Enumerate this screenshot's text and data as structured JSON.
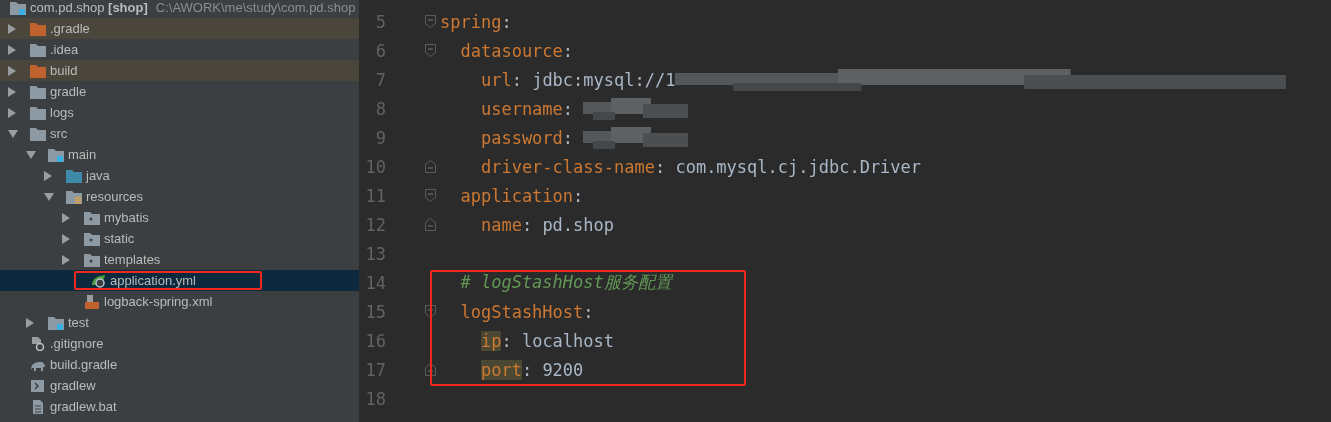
{
  "project_tree": {
    "root": {
      "name": "com.pd.shop **[shop]**",
      "path": "C:\\AWORK\\me\\study\\com.pd.shop"
    },
    "items": [
      {
        "name": ".gradle",
        "kind": "folder",
        "excluded": true,
        "expanded": false,
        "selected": false
      },
      {
        "name": ".idea",
        "kind": "folder",
        "excluded": false,
        "expanded": false,
        "selected": false
      },
      {
        "name": "build",
        "kind": "folder",
        "excluded": true,
        "expanded": false,
        "selected": false
      },
      {
        "name": "gradle",
        "kind": "folder",
        "excluded": false,
        "expanded": false,
        "selected": false
      },
      {
        "name": "logs",
        "kind": "folder",
        "excluded": false,
        "expanded": false,
        "selected": false
      },
      {
        "name": "src",
        "kind": "folder",
        "excluded": false,
        "expanded": true,
        "selected": false,
        "children": [
          {
            "name": "main",
            "kind": "module",
            "excluded": false,
            "expanded": true,
            "selected": false,
            "children": [
              {
                "name": "java",
                "kind": "source",
                "excluded": false,
                "expanded": false,
                "selected": false
              },
              {
                "name": "resources",
                "kind": "resources",
                "excluded": false,
                "expanded": true,
                "selected": false,
                "children": [
                  {
                    "name": "mybatis",
                    "kind": "package",
                    "excluded": false,
                    "expanded": false,
                    "selected": false
                  },
                  {
                    "name": "static",
                    "kind": "package",
                    "excluded": false,
                    "expanded": false,
                    "selected": false
                  },
                  {
                    "name": "templates",
                    "kind": "package",
                    "excluded": false,
                    "expanded": false,
                    "selected": false
                  },
                  {
                    "name": "application.yml",
                    "kind": "yml",
                    "excluded": false,
                    "selected": true,
                    "boxed": true
                  },
                  {
                    "name": "logback-spring.xml",
                    "kind": "xml",
                    "excluded": false,
                    "selected": false
                  }
                ]
              }
            ]
          },
          {
            "name": "test",
            "kind": "module",
            "excluded": false,
            "expanded": false,
            "selected": false
          }
        ]
      },
      {
        "name": ".gitignore",
        "kind": "ignore",
        "excluded": false,
        "selected": false
      },
      {
        "name": "build.gradle",
        "kind": "gradle",
        "excluded": false,
        "selected": false
      },
      {
        "name": "gradlew",
        "kind": "script",
        "excluded": false,
        "selected": false
      },
      {
        "name": "gradlew.bat",
        "kind": "text",
        "excluded": false,
        "selected": false
      }
    ]
  },
  "editor": {
    "lines": [
      {
        "number": "5",
        "kind": "key",
        "key": "spring",
        "colon": ":",
        "fold_start": true,
        "children": [
          {
            "number": "6",
            "kind": "key",
            "key": "datasource",
            "colon": ":",
            "fold_start": true,
            "children": [
              {
                "number": "7",
                "kind": "key",
                "key": "url",
                "colon": ":",
                "value": "jdbc:mysql://1",
                "blurred": true
              },
              {
                "number": "8",
                "kind": "key",
                "key": "username",
                "colon": ":",
                "blurred": true
              },
              {
                "number": "9",
                "kind": "key",
                "key": "password",
                "colon": ":",
                "blurred": true
              },
              {
                "number": "10",
                "kind": "key",
                "key": "driver-class-name",
                "colon": ":",
                "value": "com.mysql.cj.jdbc.Driver",
                "fold_end": true
              }
            ]
          },
          {
            "number": "11",
            "kind": "key",
            "key": "application",
            "colon": ":",
            "fold_start": true,
            "children": [
              {
                "number": "12",
                "kind": "key",
                "key": "name",
                "colon": ":",
                "value": "pd.shop",
                "fold_end": true
              }
            ]
          },
          {
            "number": "13",
            "kind": "blank"
          },
          {
            "number": "14",
            "kind": "comment",
            "text": "# logStashHost服务配置",
            "boxed": true
          },
          {
            "number": "15",
            "kind": "key",
            "key": "logStashHost",
            "colon": ":",
            "fold_start": true,
            "boxed": true,
            "children": [
              {
                "number": "16",
                "kind": "key",
                "key": "ip",
                "colon": ":",
                "value": "localhost",
                "highlighted": true,
                "boxed": true
              },
              {
                "number": "17",
                "kind": "key",
                "key": "port",
                "colon": ":",
                "value": "9200",
                "highlighted": true,
                "fold_end": true,
                "boxed": true
              }
            ]
          },
          {
            "number": "18",
            "kind": "blank"
          }
        ]
      }
    ]
  }
}
